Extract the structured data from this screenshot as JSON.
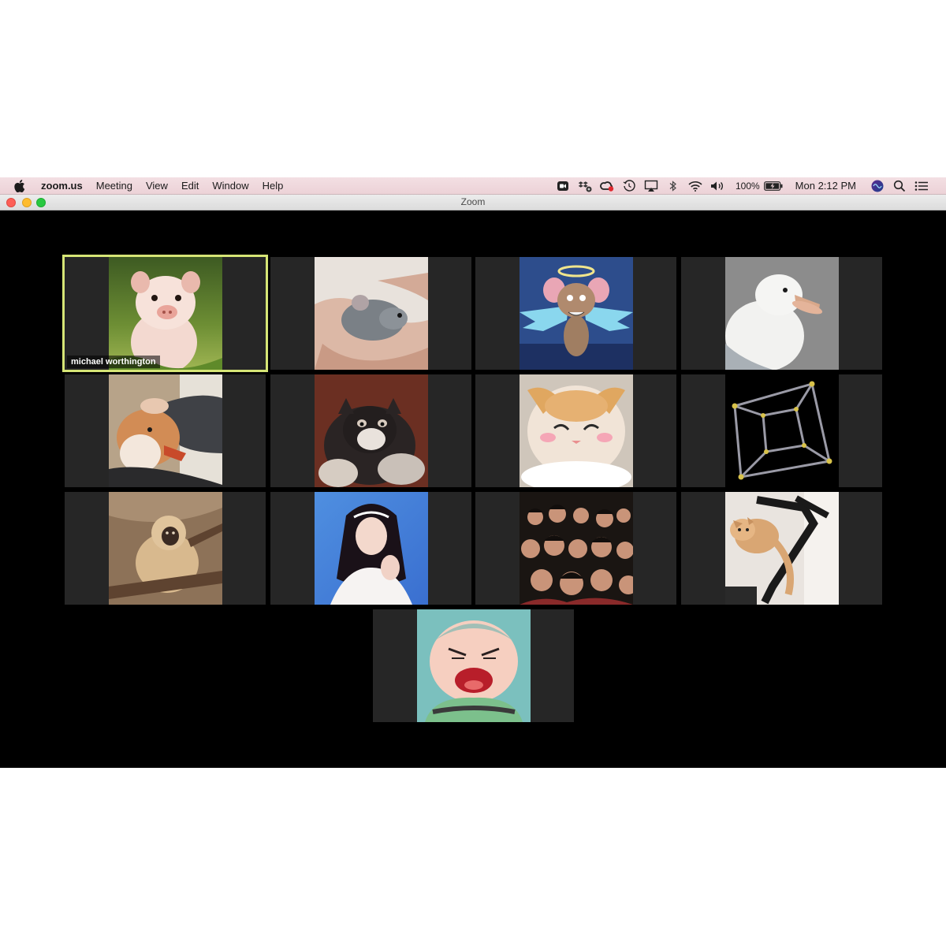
{
  "menubar": {
    "app_name": "zoom.us",
    "menus": [
      "Meeting",
      "View",
      "Edit",
      "Window",
      "Help"
    ],
    "status_icons": [
      "zoom-video-icon",
      "dropbox-icon",
      "creative-cloud-icon",
      "time-machine-icon",
      "airplay-icon",
      "bluetooth-icon",
      "wifi-icon",
      "volume-icon",
      "battery-icon"
    ],
    "battery_percent": "100%",
    "clock": "Mon 2:12 PM",
    "right_icons": [
      "siri-icon",
      "spotlight-search-icon",
      "notification-center-icon"
    ]
  },
  "window": {
    "title": "Zoom"
  },
  "gallery": {
    "active_speaker": "michael worthington",
    "tiles": [
      {
        "subject": "piglet-photo",
        "name": "michael worthington",
        "active": true
      },
      {
        "subject": "mouse-in-hands-photo"
      },
      {
        "subject": "angel-cartoon-mouse-image"
      },
      {
        "subject": "seagull-photo"
      },
      {
        "subject": "shiba-dog-photo"
      },
      {
        "subject": "husky-puppy-photo"
      },
      {
        "subject": "kitten-photo"
      },
      {
        "subject": "tesseract-render"
      },
      {
        "subject": "gibbon-photo"
      },
      {
        "subject": "woman-portrait-photo"
      },
      {
        "subject": "group-selfie-photo"
      },
      {
        "subject": "cat-on-exercise-bike-photo"
      },
      {
        "subject": "shouting-cartoon-image"
      }
    ]
  },
  "colors": {
    "active_border": "#d6e576",
    "tile_bg": "#262626",
    "meeting_bg": "#000000"
  }
}
